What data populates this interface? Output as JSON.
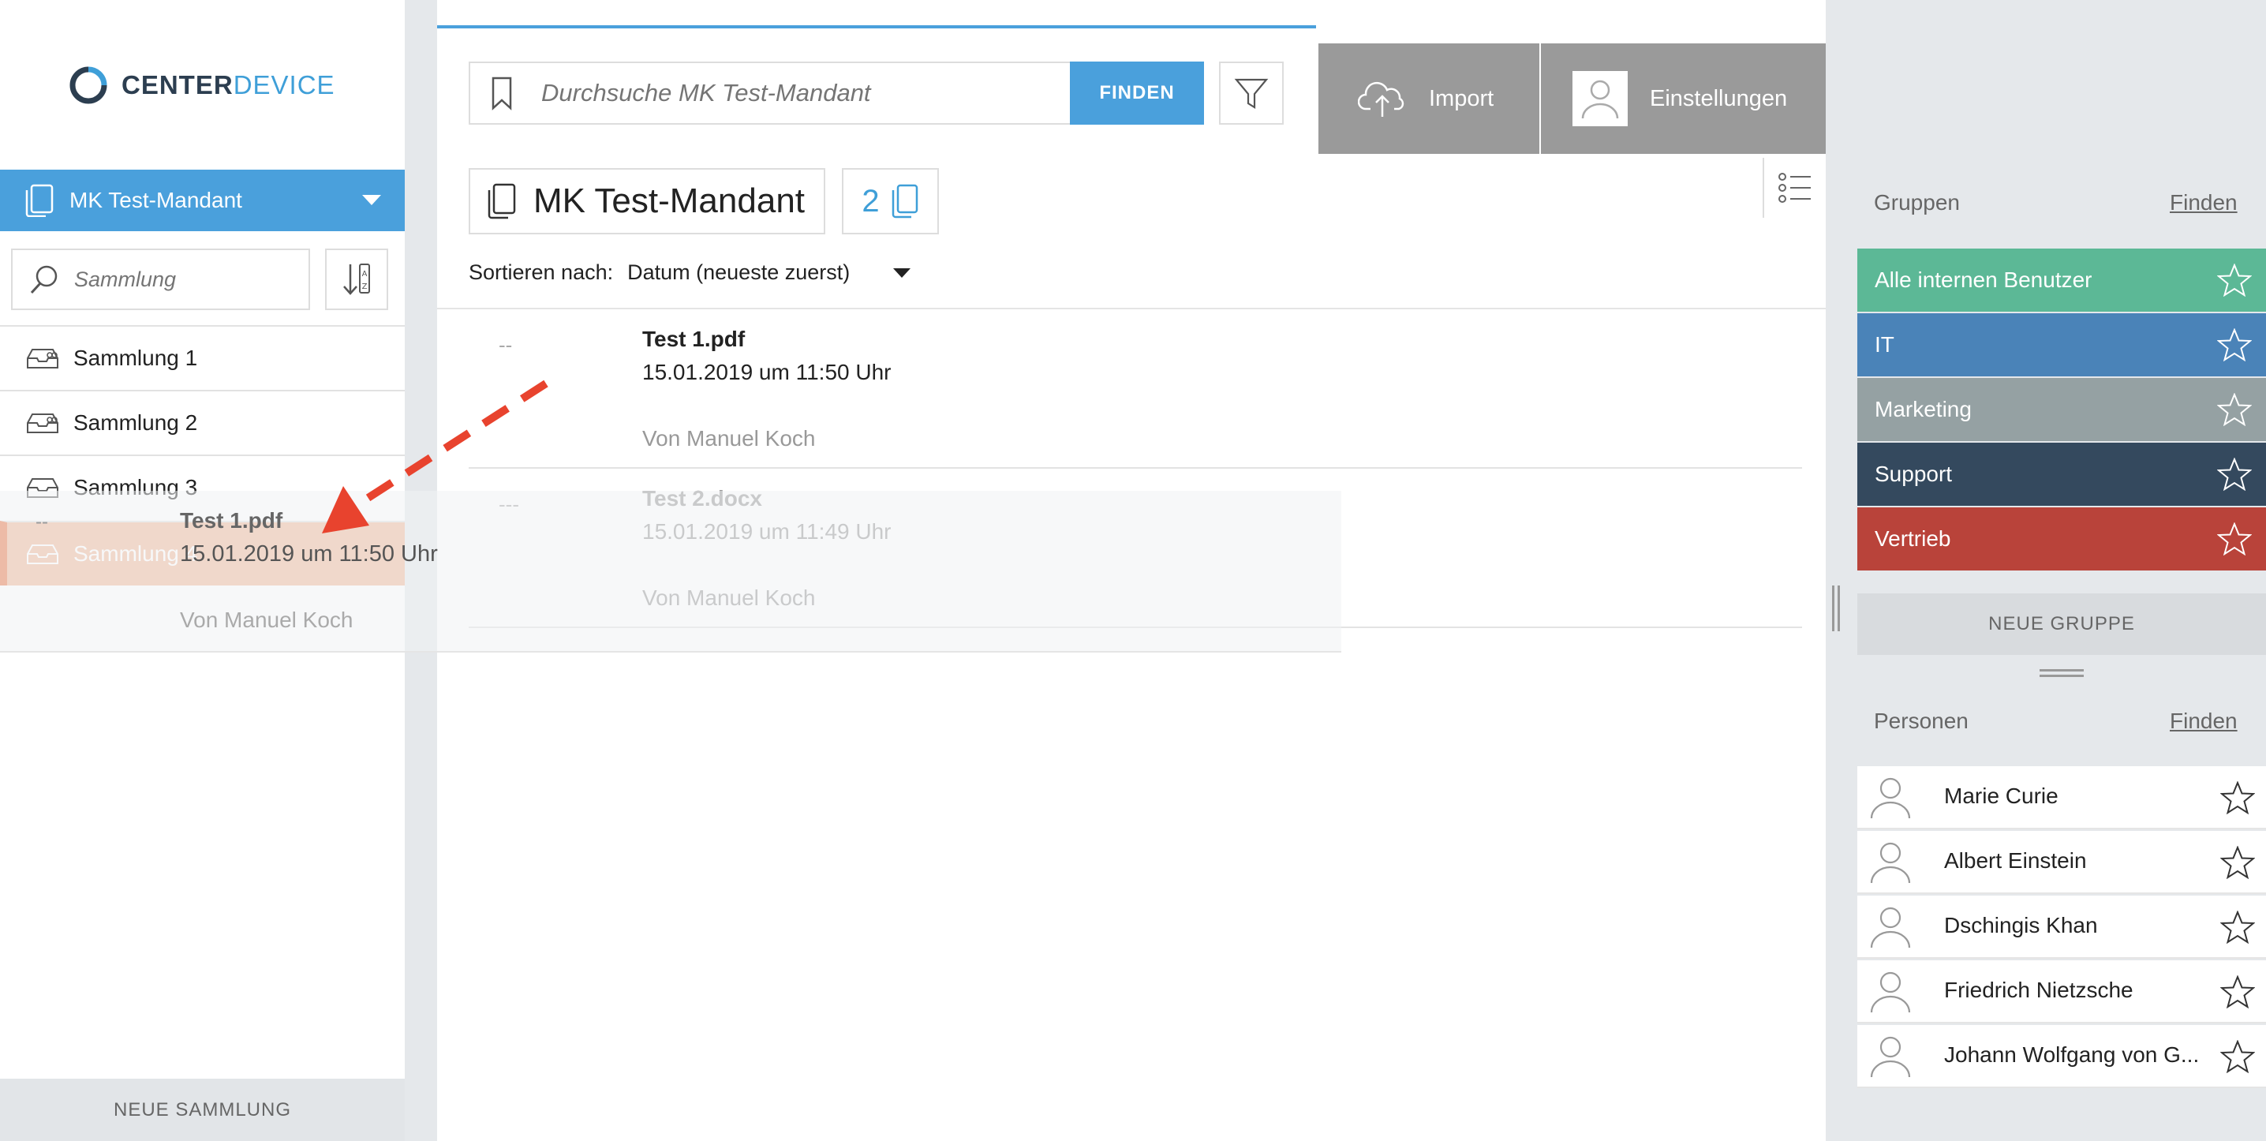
{
  "brand": {
    "logo_part1": "CENTER",
    "logo_part2": "DEVICE"
  },
  "sidebar": {
    "mandant": "MK Test-Mandant",
    "search_placeholder": "Sammlung",
    "collections": [
      {
        "label": "Sammlung 1"
      },
      {
        "label": "Sammlung 2"
      },
      {
        "label": "Sammlung 3"
      },
      {
        "label": "Sammlung 4"
      }
    ],
    "new_collection": "NEUE SAMMLUNG"
  },
  "search": {
    "placeholder": "Durchsuche MK Test-Mandant",
    "find_label": "FINDEN"
  },
  "toolbar": {
    "import_label": "Import",
    "settings_label": "Einstellungen"
  },
  "main": {
    "title": "MK Test-Mandant",
    "doc_count": "2",
    "sort_label": "Sortieren nach:",
    "sort_value": "Datum (neueste zuerst)",
    "documents": [
      {
        "dash": "--",
        "name": "Test 1.pdf",
        "date": "15.01.2019 um 11:50 Uhr",
        "by": "Von Manuel Koch"
      },
      {
        "dash": "---",
        "name": "Test 2.docx",
        "date": "15.01.2019 um 11:49 Uhr",
        "by": "Von Manuel Koch"
      }
    ]
  },
  "drag_ghost": {
    "dash": "--",
    "name": "Test 1.pdf",
    "date": "15.01.2019 um 11:50 Uhr",
    "by": "Von Manuel Koch"
  },
  "groups": {
    "title": "Gruppen",
    "find_link": "Finden",
    "items": [
      {
        "label": "Alle internen Benutzer",
        "color": "#5cb896"
      },
      {
        "label": "IT",
        "color": "#4a83b8"
      },
      {
        "label": "Marketing",
        "color": "#95a1a3"
      },
      {
        "label": "Support",
        "color": "#34495e"
      },
      {
        "label": "Vertrieb",
        "color": "#b9433a"
      }
    ],
    "new_group": "NEUE GRUPPE"
  },
  "persons": {
    "title": "Personen",
    "find_link": "Finden",
    "items": [
      {
        "name": "Marie Curie"
      },
      {
        "name": "Albert Einstein"
      },
      {
        "name": "Dschingis Khan"
      },
      {
        "name": "Friedrich Nietzsche"
      },
      {
        "name": "Johann Wolfgang von G..."
      }
    ]
  },
  "colors": {
    "accent": "#4aa0dc",
    "drop_target": "#f0b89a",
    "drop_border": "#e8794a",
    "arrow": "#e8432e"
  }
}
